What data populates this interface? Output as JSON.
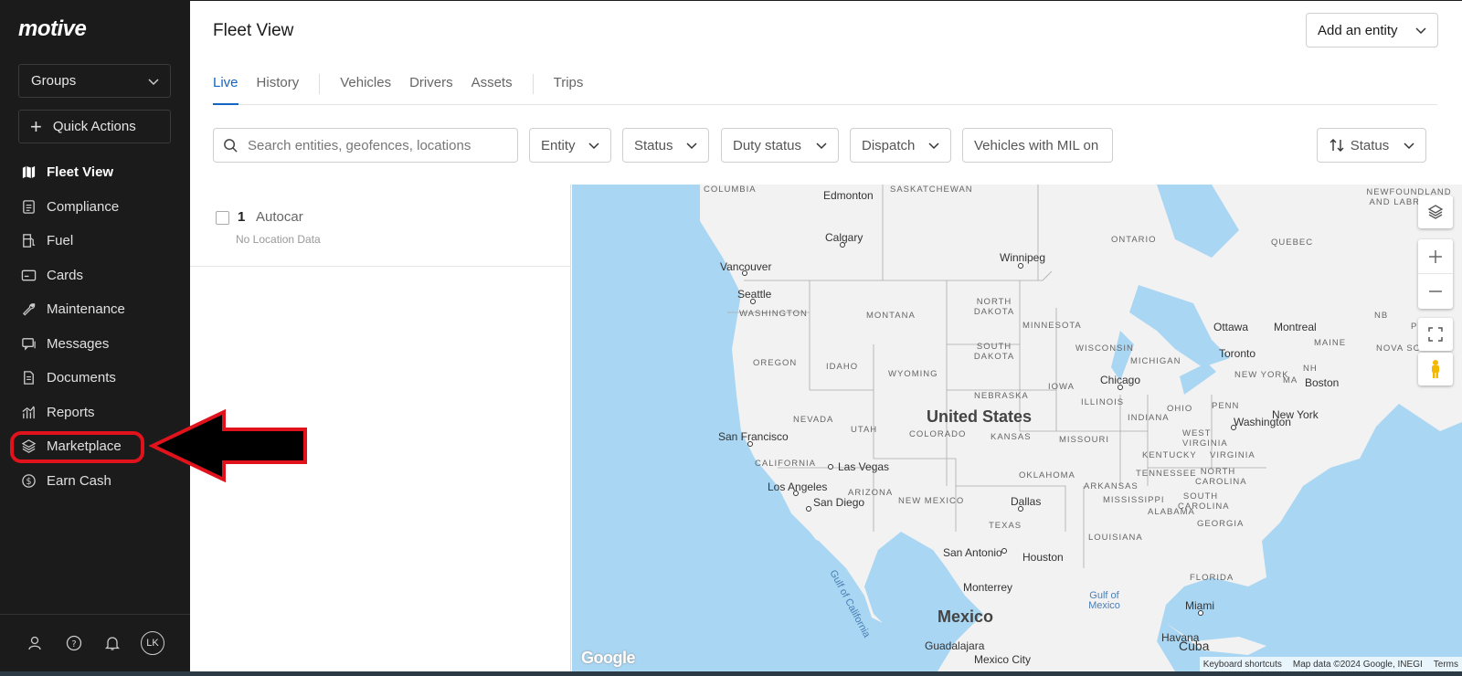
{
  "brand": "motive",
  "sidebar": {
    "groups_label": "Groups",
    "quick_actions_label": "Quick Actions",
    "items": [
      {
        "label": "Fleet View",
        "icon": "map-icon"
      },
      {
        "label": "Compliance",
        "icon": "clipboard-icon"
      },
      {
        "label": "Fuel",
        "icon": "fuel-pump-icon"
      },
      {
        "label": "Cards",
        "icon": "card-icon"
      },
      {
        "label": "Maintenance",
        "icon": "wrench-icon"
      },
      {
        "label": "Messages",
        "icon": "chat-icon"
      },
      {
        "label": "Documents",
        "icon": "document-icon"
      },
      {
        "label": "Reports",
        "icon": "chart-icon"
      },
      {
        "label": "Marketplace",
        "icon": "layers-icon"
      },
      {
        "label": "Earn Cash",
        "icon": "dollar-icon"
      }
    ],
    "bottom": {
      "avatar_initials": "LK"
    }
  },
  "header": {
    "title": "Fleet View",
    "add_entity_label": "Add an entity"
  },
  "tabs": [
    "Live",
    "History",
    "Vehicles",
    "Drivers",
    "Assets",
    "Trips"
  ],
  "filters": {
    "search_placeholder": "Search entities, geofences, locations",
    "entity": "Entity",
    "status": "Status",
    "duty_status": "Duty status",
    "dispatch": "Dispatch",
    "mil": "Vehicles with MIL on",
    "sort": "Status"
  },
  "list": [
    {
      "num": "1",
      "name": "Autocar",
      "sub": "No Location Data"
    }
  ],
  "map": {
    "countries": [
      "United States",
      "Mexico"
    ],
    "cities": [
      "Edmonton",
      "Calgary",
      "Vancouver",
      "Seattle",
      "Winnipeg",
      "Ottawa",
      "Montreal",
      "Toronto",
      "Boston",
      "Chicago",
      "New York",
      "Washington",
      "San Francisco",
      "Las Vegas",
      "Los Angeles",
      "San Diego",
      "Dallas",
      "San Antonio",
      "Houston",
      "Monterrey",
      "Miami",
      "Havana",
      "Cuba",
      "Guadalajara",
      "Mexico City"
    ],
    "states": [
      "COLUMBIA",
      "SASKATCHEWAN",
      "ONTARIO",
      "QUEBEC",
      "NEWFOUNDLAND AND LABRADOR",
      "WASHINGTON",
      "MONTANA",
      "NORTH DAKOTA",
      "MINNESOTA",
      "SOUTH DAKOTA",
      "WISCONSIN",
      "MICHIGAN",
      "OREGON",
      "IDAHO",
      "WYOMING",
      "IOWA",
      "NEBRASKA",
      "ILLINOIS",
      "OHIO",
      "PENN",
      "NEW YORK",
      "NEVADA",
      "UTAH",
      "COLORADO",
      "KANSAS",
      "MISSOURI",
      "INDIANA",
      "WEST VIRGINIA",
      "VIRGINIA",
      "KENTUCKY",
      "CALIFORNIA",
      "ARIZONA",
      "NEW MEXICO",
      "OKLAHOMA",
      "ARKANSAS",
      "TENNESSEE",
      "NORTH CAROLINA",
      "SOUTH CAROLINA",
      "MISSISSIPPI",
      "ALABAMA",
      "GEORGIA",
      "TEXAS",
      "LOUISIANA",
      "FLORIDA",
      "MAINE",
      "NOVA SCOTIA",
      "NB",
      "PE",
      "NH",
      "MA"
    ],
    "waters": [
      "Gulf of California",
      "Gulf of Mexico"
    ],
    "logo": "Google",
    "attribution": [
      "Keyboard shortcuts",
      "Map data ©2024 Google, INEGI",
      "Terms"
    ]
  },
  "colors": {
    "accent": "#1565c0",
    "sidebar_bg": "#1b1b1b",
    "highlight": "#e0121b"
  }
}
